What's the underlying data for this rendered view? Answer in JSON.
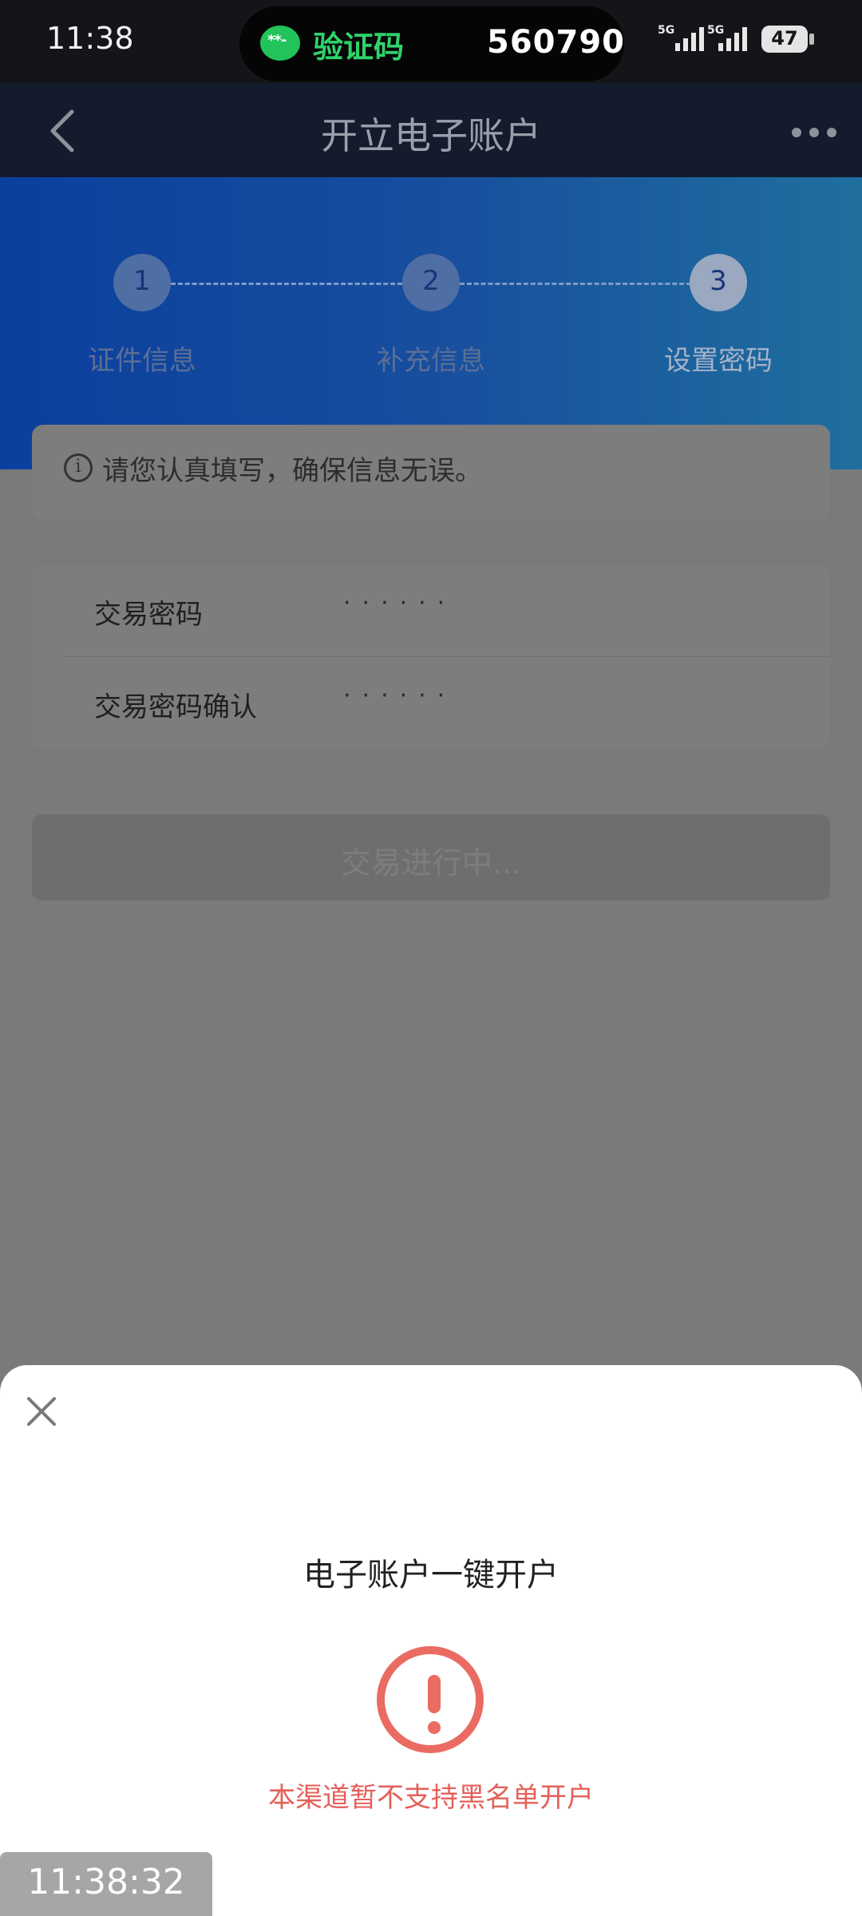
{
  "status_bar": {
    "time": "11:38",
    "pill_label": "验证码",
    "pill_code": "560790",
    "pill_icon_text": "**-",
    "signal_1": "5G",
    "signal_2": "5G",
    "battery": "47"
  },
  "nav": {
    "title": "开立电子账户"
  },
  "steps": [
    {
      "number": "1",
      "label": "证件信息"
    },
    {
      "number": "2",
      "label": "补充信息"
    },
    {
      "number": "3",
      "label": "设置密码"
    }
  ],
  "notice": {
    "icon_glyph": "i",
    "text": "请您认真填写，确保信息无误。"
  },
  "password_form": {
    "rows": [
      {
        "label": "交易密码",
        "value": "······"
      },
      {
        "label": "交易密码确认",
        "value": "······"
      }
    ]
  },
  "submit": {
    "label": "交易进行中..."
  },
  "sheet": {
    "title": "电子账户一键开户",
    "error_message": "本渠道暂不支持黑名单开户"
  },
  "timestamp": "11:38:32",
  "colors": {
    "error": "#ea6b62",
    "status_green": "#2fd36b",
    "nav_bg": "#141b2d"
  }
}
